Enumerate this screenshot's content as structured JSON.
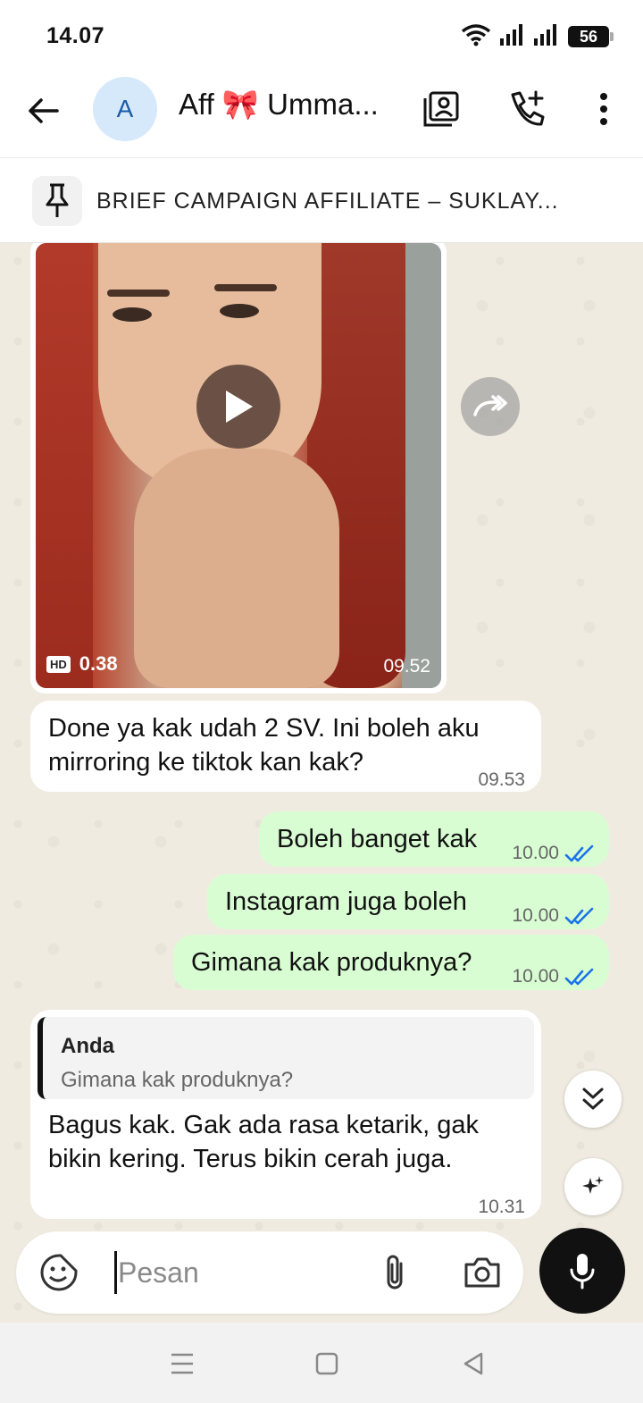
{
  "status_bar": {
    "time": "14.07",
    "battery": "56",
    "icons": [
      "wifi-icon",
      "signal-icon",
      "signal-icon",
      "battery-icon"
    ]
  },
  "header": {
    "back_icon": "back-arrow-icon",
    "avatar_initial": "A",
    "title": "Aff 🎀 Umma...",
    "actions": [
      "contact-card-icon",
      "add-call-icon",
      "more-vert-icon"
    ]
  },
  "pinned": {
    "icon": "pin-icon",
    "text": "BRIEF CAMPAIGN AFFILIATE – SUKLAY..."
  },
  "messages": {
    "video": {
      "duration": "0.38",
      "hd_label": "HD",
      "time": "09.52"
    },
    "m1": {
      "line1": "Done ya kak udah 2 SV. Ini boleh aku",
      "line2": "mirroring ke tiktok kan kak?",
      "time": "09.53"
    },
    "m2": {
      "text": "Boleh banget kak",
      "time": "10.00"
    },
    "m3": {
      "text": "Instagram juga boleh",
      "time": "10.00"
    },
    "m4": {
      "text": "Gimana kak produknya?",
      "time": "10.00"
    },
    "m5": {
      "quote_author": "Anda",
      "quote_text": "Gimana kak produknya?",
      "line1": "Bagus kak. Gak ada rasa ketarik, gak",
      "line2": "bikin kering. Terus bikin cerah juga.",
      "time": "10.31"
    }
  },
  "composer": {
    "placeholder": "Pesan",
    "icons": [
      "sticker-icon",
      "attach-icon",
      "camera-icon",
      "mic-icon"
    ]
  },
  "colors": {
    "outgoing_bubble": "#d9fdd3",
    "incoming_bubble": "#ffffff",
    "read_ticks": "#1a73e8",
    "chat_background": "#f0ebe0"
  }
}
